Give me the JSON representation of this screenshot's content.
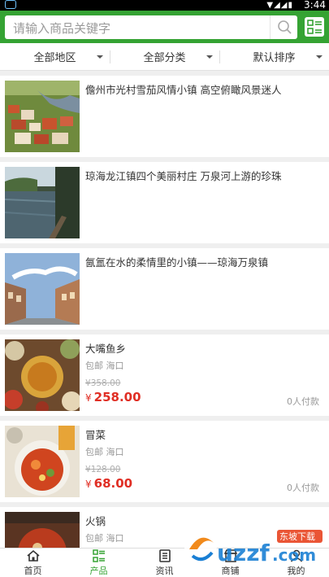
{
  "status": {
    "time": "3:44"
  },
  "search": {
    "placeholder": "请输入商品关键字"
  },
  "filters": [
    {
      "label": "全部地区"
    },
    {
      "label": "全部分类"
    },
    {
      "label": "默认排序"
    }
  ],
  "articles": [
    {
      "title": "儋州市光村雪茄风情小镇 高空俯瞰风景迷人"
    },
    {
      "title": "琼海龙江镇四个美丽村庄 万泉河上游的珍珠"
    },
    {
      "title": "氤氲在水的柔情里的小镇——琼海万泉镇"
    }
  ],
  "products": [
    {
      "name": "大嘴鱼乡",
      "shipping": "包邮 海口",
      "old_price_symbol": "¥",
      "old_price": "358.00",
      "price_symbol": "¥",
      "price": "258.00",
      "paid": "0人付款"
    },
    {
      "name": "冒菜",
      "shipping": "包邮 海口",
      "old_price_symbol": "¥",
      "old_price": "128.00",
      "price_symbol": "¥",
      "price": "68.00",
      "paid": "0人付款"
    },
    {
      "name": "火锅",
      "shipping": "包邮 海口"
    }
  ],
  "tabs": [
    {
      "label": "首页",
      "icon": "home-icon"
    },
    {
      "label": "产品",
      "icon": "list-icon",
      "active": true
    },
    {
      "label": "资讯",
      "icon": "news-icon"
    },
    {
      "label": "商铺",
      "icon": "shop-icon"
    },
    {
      "label": "我的",
      "icon": "user-icon"
    }
  ],
  "watermark": {
    "brand": "uzzf",
    "domain": ".com",
    "tag": "东坡下载"
  },
  "colors": {
    "brand_green": "#35a333",
    "price_red": "#e02e24"
  }
}
